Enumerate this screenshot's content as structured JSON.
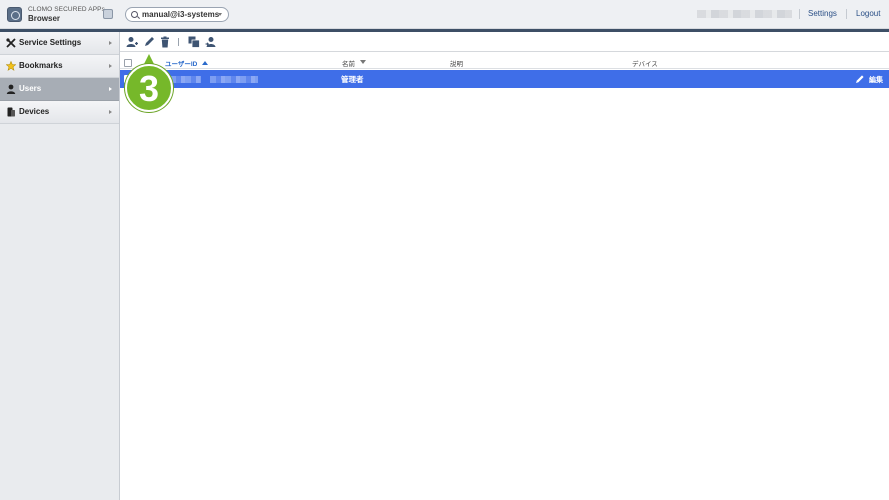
{
  "app": {
    "title": "CLOMO SECURED APPs",
    "subtitle": "Browser"
  },
  "header": {
    "account": "manual@i3-systems",
    "settings_label": "Settings",
    "logout_label": "Logout"
  },
  "sidebar": {
    "items": [
      {
        "label": "Service Settings",
        "icon": "tools-icon",
        "active": false
      },
      {
        "label": "Bookmarks",
        "icon": "star-icon",
        "active": false
      },
      {
        "label": "Users",
        "icon": "user-icon",
        "active": true
      },
      {
        "label": "Devices",
        "icon": "devices-icon",
        "active": false
      }
    ]
  },
  "toolbar": {
    "buttons": [
      "add-user-icon",
      "edit-icon",
      "delete-icon",
      "copy-icon",
      "import-user-icon"
    ]
  },
  "table": {
    "columns": [
      "ユーザーID",
      "名前",
      "説明",
      "デバイス"
    ],
    "sorted_column": "ユーザーID",
    "rows": [
      {
        "user_id": "",
        "name": "管理者",
        "description": "",
        "device": "",
        "action_label": "編集"
      }
    ]
  },
  "step_badge": "3",
  "colors": {
    "header_stripe": "#3d4f66",
    "selected_row": "#3f6ee8",
    "accent_link": "#2a4f86",
    "sort_blue": "#2a6acb",
    "badge_green": "#76b82a"
  }
}
